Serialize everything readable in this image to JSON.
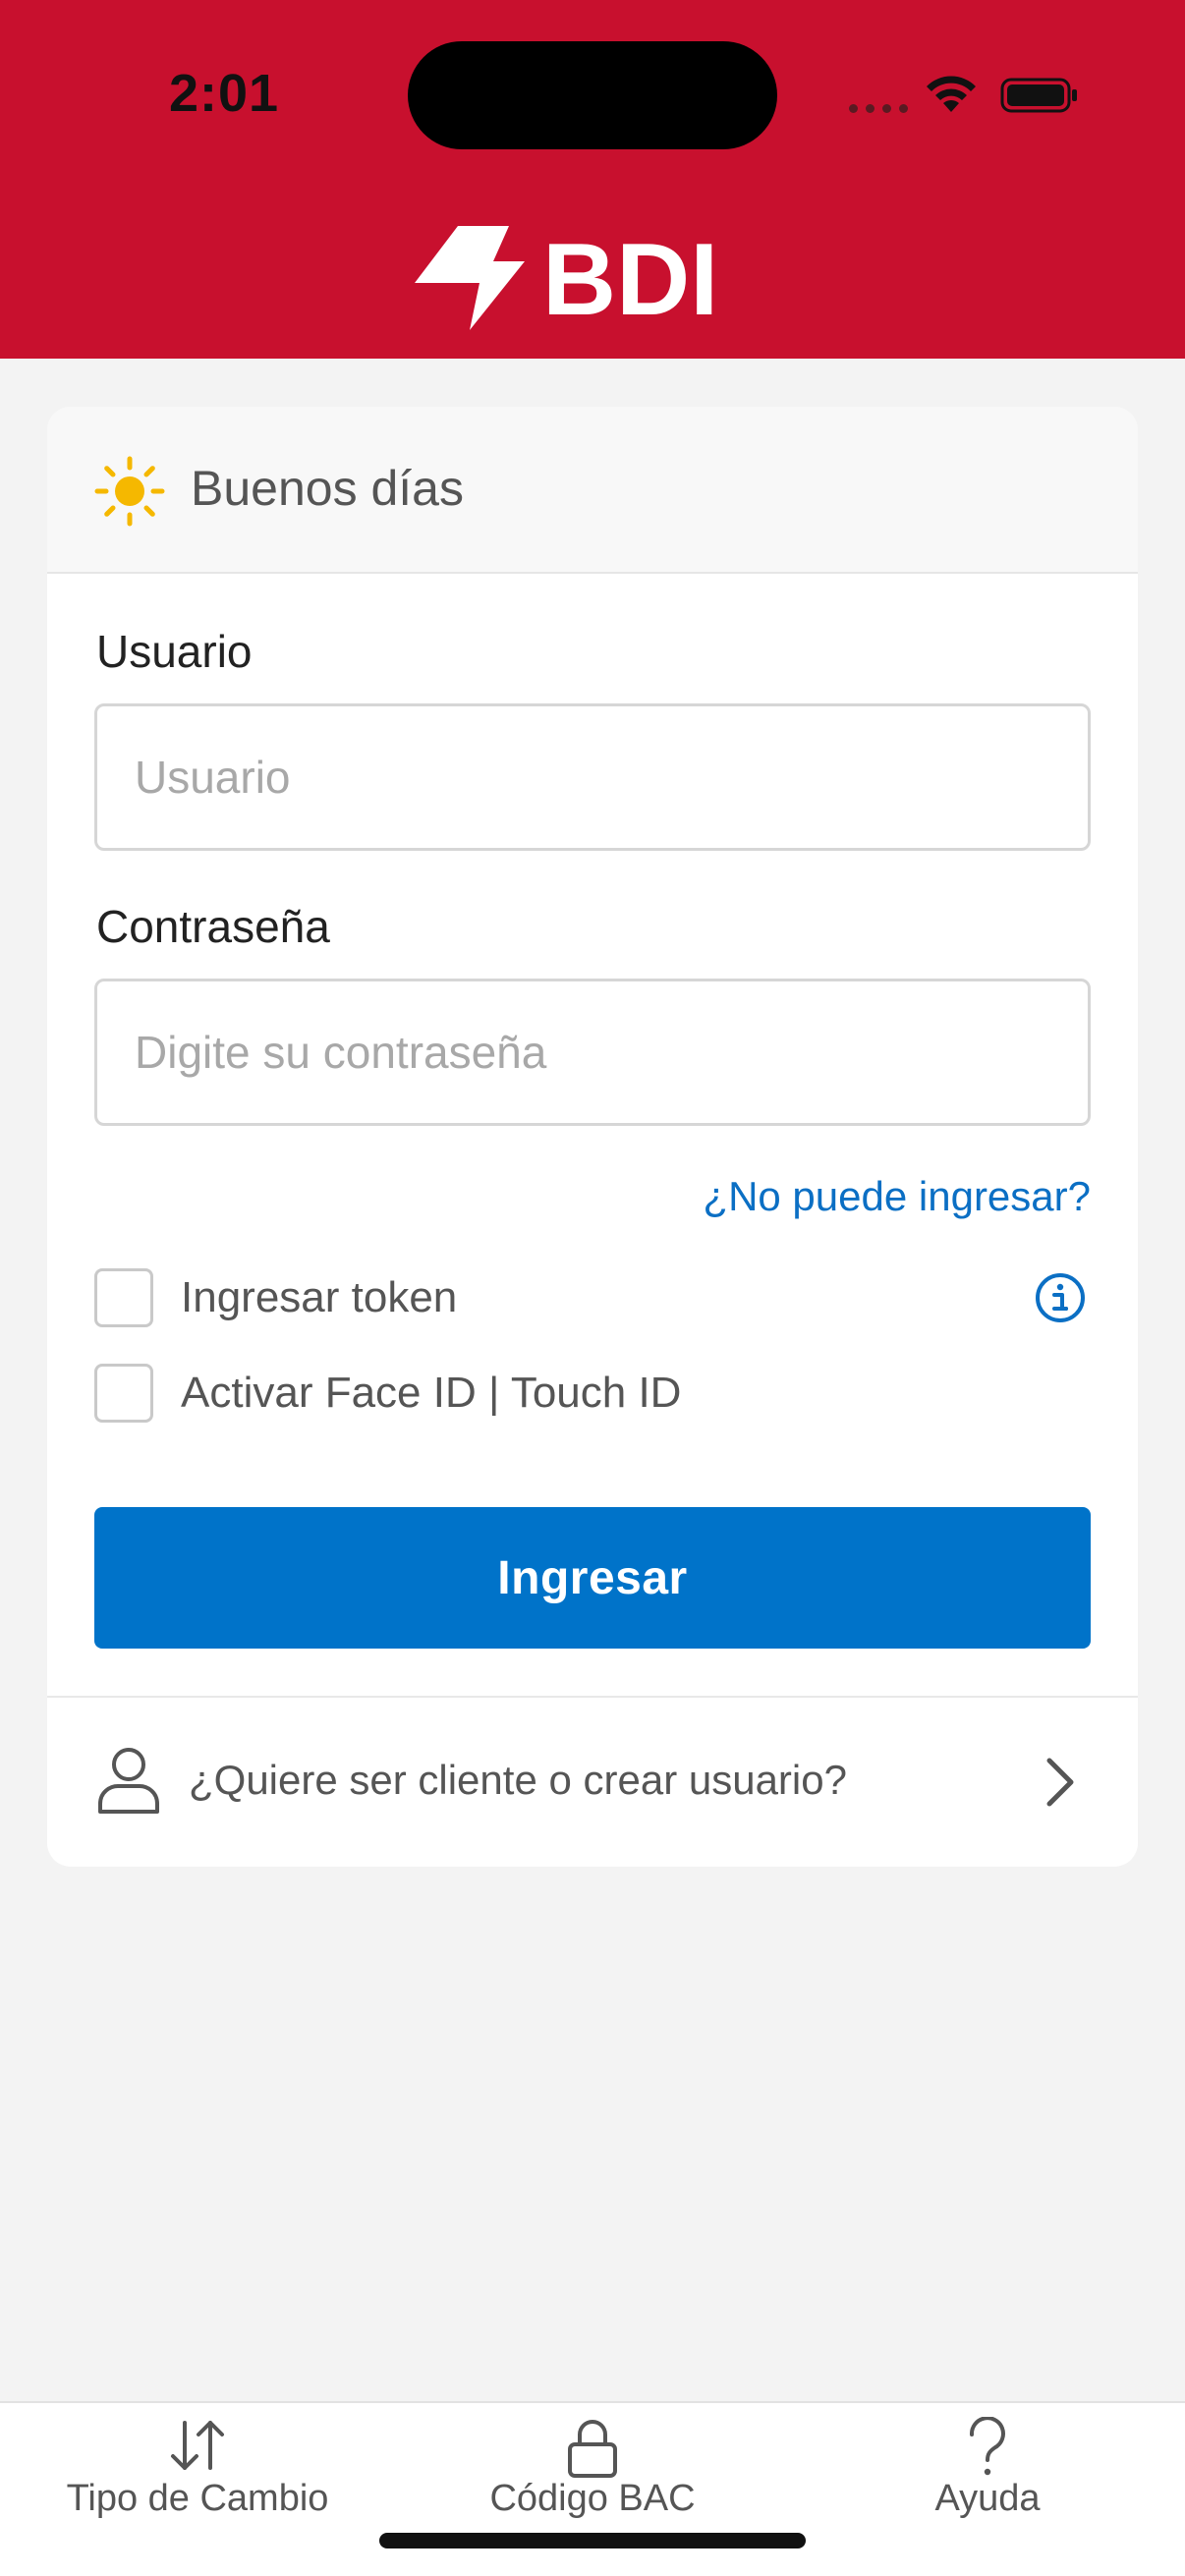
{
  "status_bar": {
    "time": "2:01"
  },
  "header": {
    "brand": "BDI",
    "brand_color": "#c8102e"
  },
  "greeting": {
    "icon": "sun-icon",
    "text": "Buenos días"
  },
  "form": {
    "username": {
      "label": "Usuario",
      "placeholder": "Usuario",
      "value": ""
    },
    "password": {
      "label": "Contraseña",
      "placeholder": "Digite su contraseña",
      "value": ""
    },
    "forgot_link": "¿No puede ingresar?",
    "token_checkbox": {
      "label": "Ingresar token",
      "checked": false
    },
    "biometric_checkbox": {
      "label": "Activar Face ID | Touch ID",
      "checked": false
    },
    "submit_label": "Ingresar",
    "accent_color": "#0073c9"
  },
  "signup": {
    "icon": "user-icon",
    "text": "¿Quiere ser cliente o crear usuario?"
  },
  "tab_bar": {
    "items": [
      {
        "label": "Tipo de Cambio",
        "icon": "exchange-arrows-icon"
      },
      {
        "label": "Código BAC",
        "icon": "lock-icon"
      },
      {
        "label": "Ayuda",
        "icon": "question-icon"
      }
    ]
  }
}
